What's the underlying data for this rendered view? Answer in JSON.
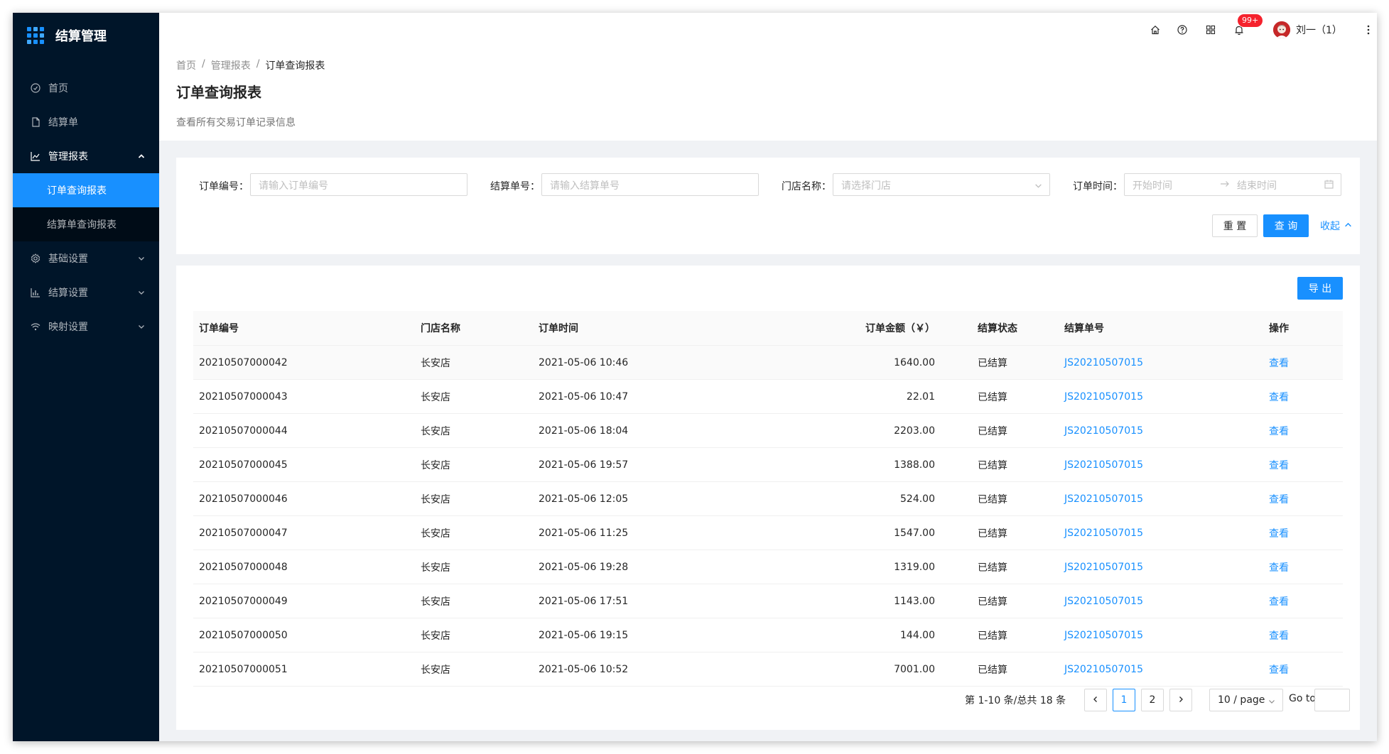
{
  "app": {
    "title": "结算管理"
  },
  "sidebar": {
    "items": [
      {
        "label": "首页",
        "icon": "dashboard-icon"
      },
      {
        "label": "结算单",
        "icon": "file-icon"
      },
      {
        "label": "管理报表",
        "icon": "line-chart-icon",
        "open": true,
        "children": [
          {
            "label": "订单查询报表",
            "active": true
          },
          {
            "label": "结算单查询报表"
          }
        ]
      },
      {
        "label": "基础设置",
        "icon": "setting-icon"
      },
      {
        "label": "结算设置",
        "icon": "bar-chart-icon"
      },
      {
        "label": "映射设置",
        "icon": "wifi-icon"
      }
    ]
  },
  "header": {
    "badge": "99+",
    "user": "刘一（1）"
  },
  "breadcrumb": [
    "首页",
    "管理报表",
    "订单查询报表"
  ],
  "page": {
    "title": "订单查询报表",
    "description": "查看所有交易订单记录信息"
  },
  "filters": {
    "order_no": {
      "label": "订单编号：",
      "placeholder": "请输入订单编号"
    },
    "settle_no": {
      "label": "结算单号：",
      "placeholder": "请输入结算单号"
    },
    "store": {
      "label": "门店名称：",
      "placeholder": "请选择门店"
    },
    "time": {
      "label": "订单时间：",
      "start": "开始时间",
      "end": "结束时间"
    },
    "reset": "重 置",
    "search": "查 询",
    "collapse": "收起"
  },
  "table": {
    "export": "导 出",
    "columns": [
      "订单编号",
      "门店名称",
      "订单时间",
      "订单金额（￥）",
      "结算状态",
      "结算单号",
      "操作"
    ],
    "rows": [
      [
        "20210507000042",
        "长安店",
        "2021-05-06 10:46",
        "1640.00",
        "已结算",
        "JS20210507015",
        "查看"
      ],
      [
        "20210507000043",
        "长安店",
        "2021-05-06 10:47",
        "22.01",
        "已结算",
        "JS20210507015",
        "查看"
      ],
      [
        "20210507000044",
        "长安店",
        "2021-05-06 18:04",
        "2203.00",
        "已结算",
        "JS20210507015",
        "查看"
      ],
      [
        "20210507000045",
        "长安店",
        "2021-05-06 19:57",
        "1388.00",
        "已结算",
        "JS20210507015",
        "查看"
      ],
      [
        "20210507000046",
        "长安店",
        "2021-05-06 12:05",
        "524.00",
        "已结算",
        "JS20210507015",
        "查看"
      ],
      [
        "20210507000047",
        "长安店",
        "2021-05-06 11:25",
        "1547.00",
        "已结算",
        "JS20210507015",
        "查看"
      ],
      [
        "20210507000048",
        "长安店",
        "2021-05-06 19:28",
        "1319.00",
        "已结算",
        "JS20210507015",
        "查看"
      ],
      [
        "20210507000049",
        "长安店",
        "2021-05-06 17:51",
        "1143.00",
        "已结算",
        "JS20210507015",
        "查看"
      ],
      [
        "20210507000050",
        "长安店",
        "2021-05-06 19:15",
        "144.00",
        "已结算",
        "JS20210507015",
        "查看"
      ],
      [
        "20210507000051",
        "长安店",
        "2021-05-06 10:52",
        "7001.00",
        "已结算",
        "JS20210507015",
        "查看"
      ]
    ]
  },
  "pagination": {
    "total": "第 1-10 条/总共 18 条",
    "pages": [
      "1",
      "2"
    ],
    "current": "1",
    "page_size": "10 / page",
    "goto": "Go to"
  },
  "colors": {
    "primary": "#1890ff",
    "sidebar": "#001529",
    "submenu": "#000c17",
    "badge": "#f5222d"
  }
}
